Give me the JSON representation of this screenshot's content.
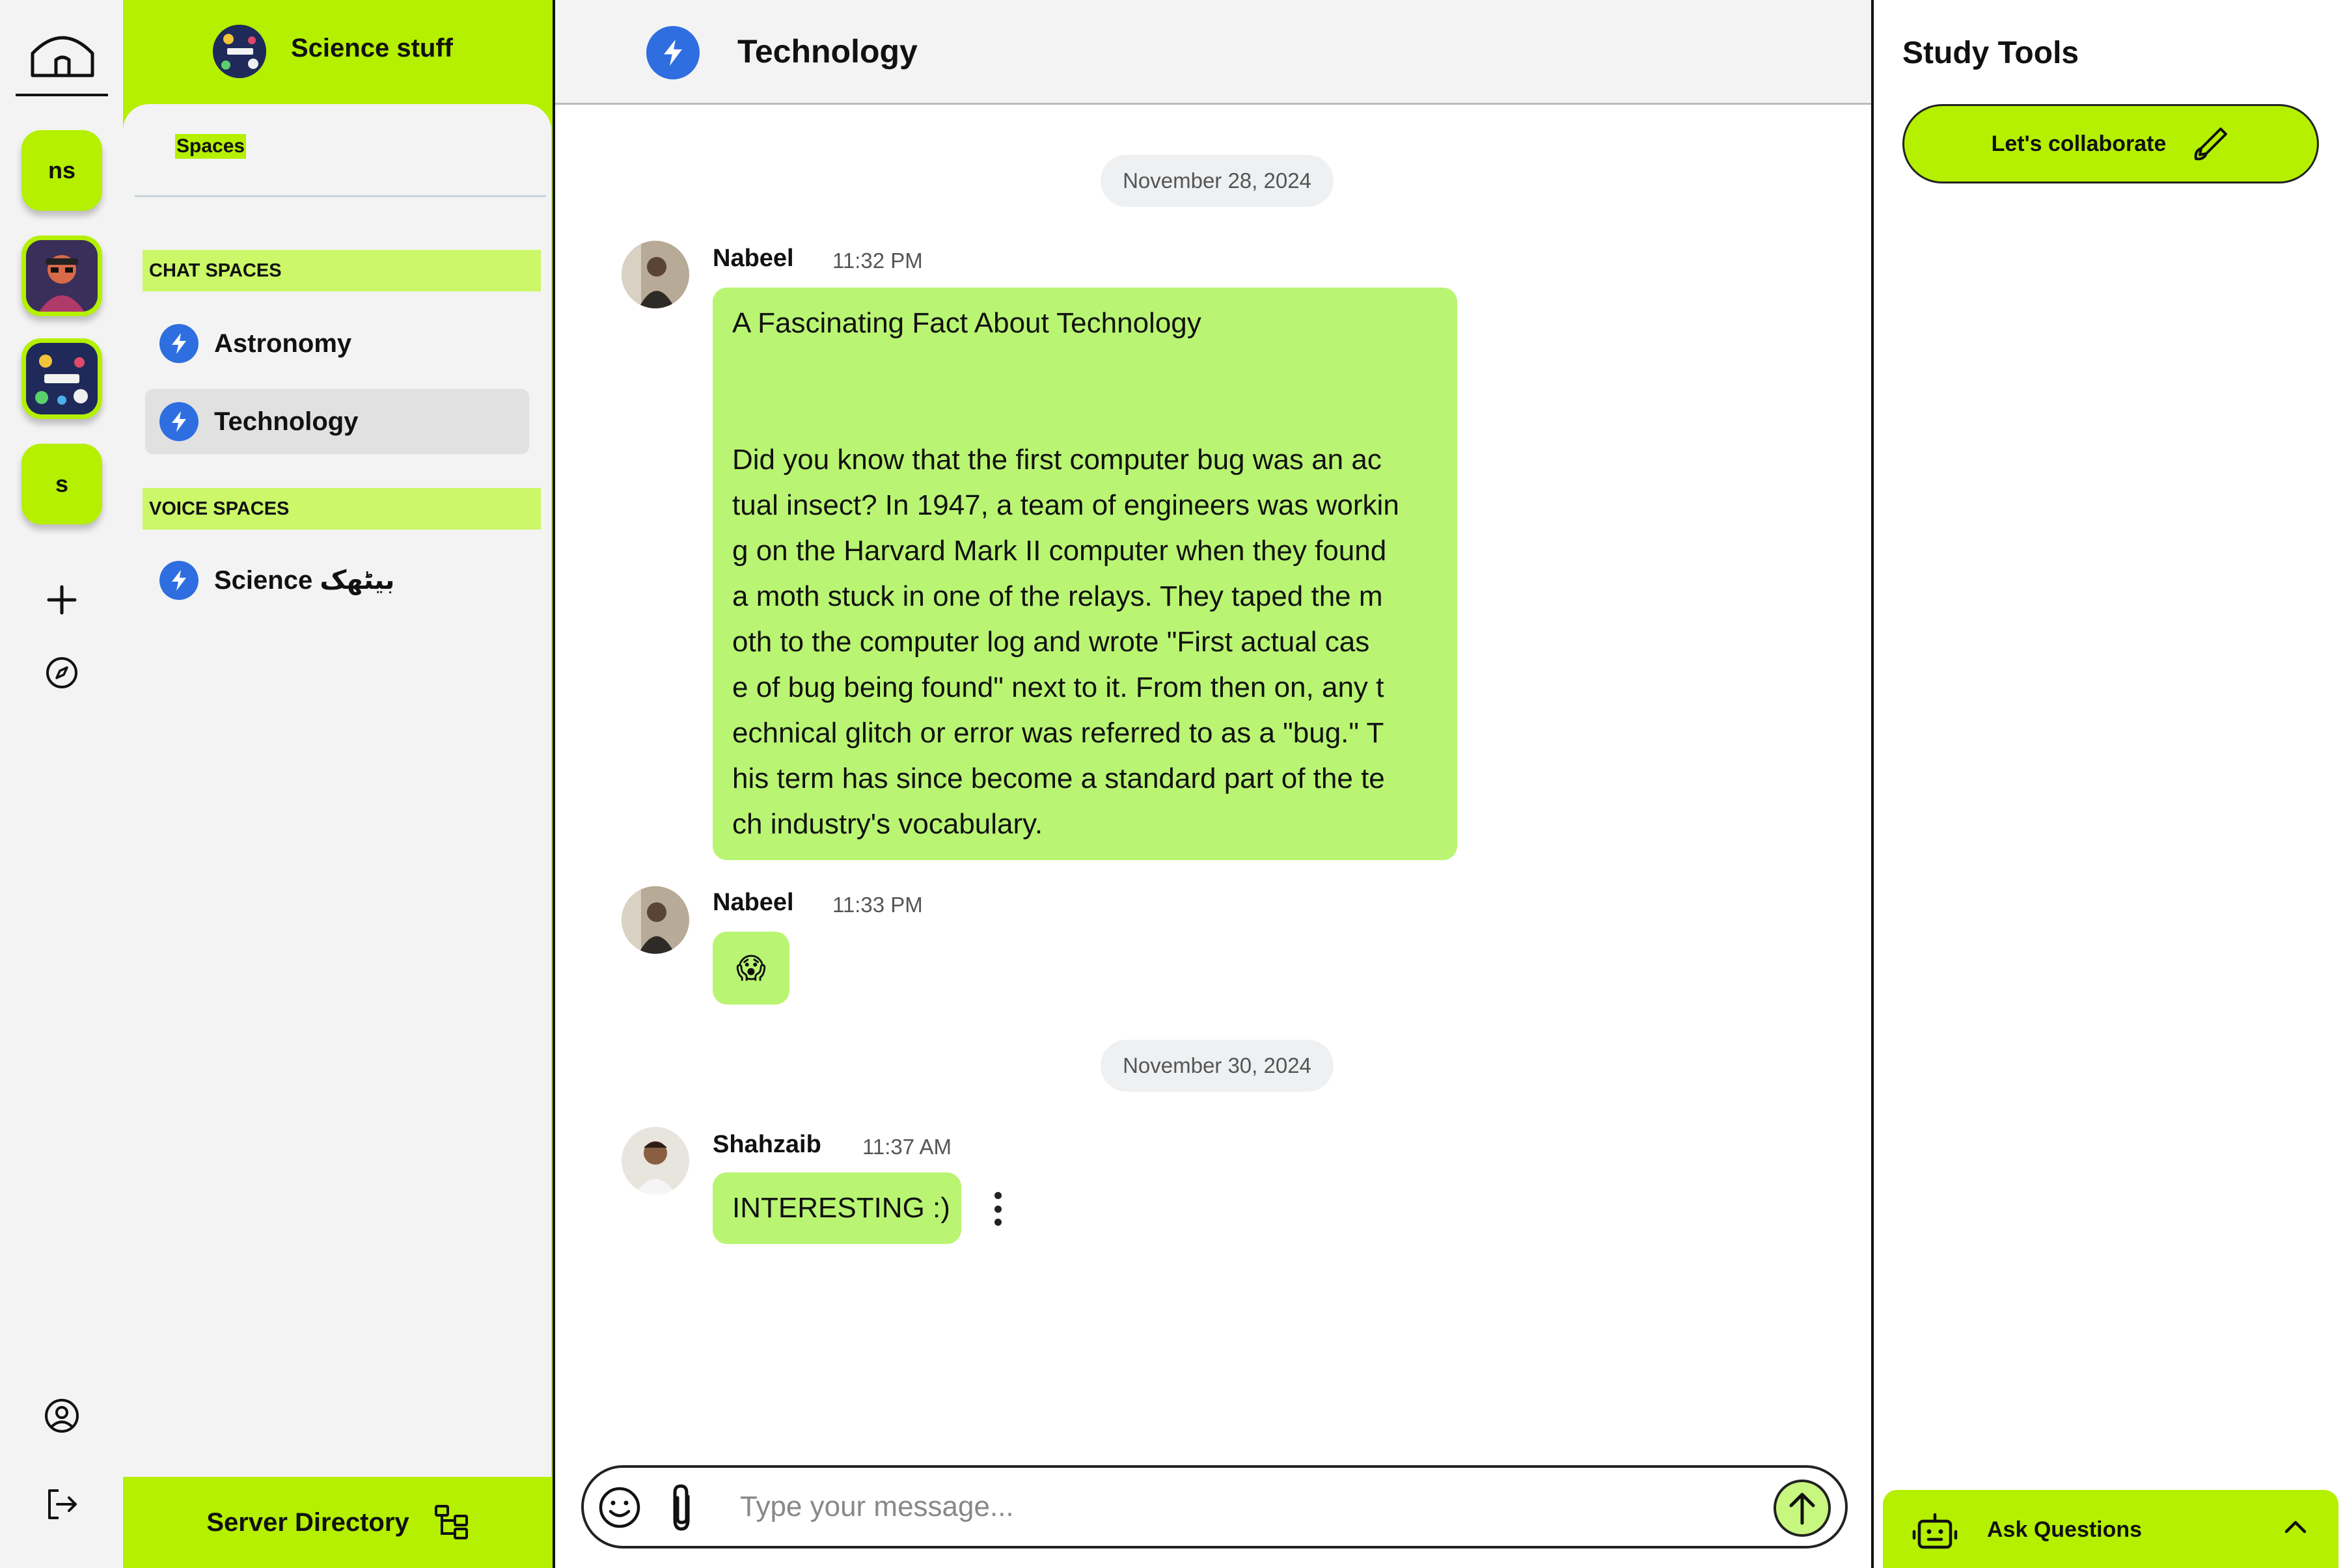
{
  "rail": {
    "servers": [
      {
        "label": "ns"
      },
      {
        "label": ""
      },
      {
        "label": ""
      },
      {
        "label": "s"
      }
    ]
  },
  "sidebar": {
    "server_name": "Science stuff",
    "spaces_tab": "Spaces",
    "chat_section": "CHAT SPACES",
    "chat_channels": [
      {
        "label": "Astronomy",
        "active": false
      },
      {
        "label": "Technology",
        "active": true
      }
    ],
    "voice_section": "VOICE SPACES",
    "voice_channels": [
      {
        "label": "Science بیٹھک"
      }
    ],
    "server_directory": "Server Directory"
  },
  "chat": {
    "channel_title": "Technology",
    "dates": [
      "November 28, 2024",
      "November 30, 2024"
    ],
    "messages": [
      {
        "sender": "Nabeel",
        "time": "11:32 PM",
        "text_lines": [
          "A Fascinating Fact About Technology",
          "",
          "",
          "Did you know that the first computer bug was an ac",
          "tual insect? In 1947, a team of engineers was workin",
          "g on the Harvard Mark II computer when they found",
          "a moth stuck in one of the relays. They taped the m",
          "oth to the computer log and wrote \"First actual cas",
          "e of bug being found\" next to it. From then on, any t",
          "echnical glitch or error was referred to as a \"bug.\" T",
          "his term has since become a standard part of the te",
          "ch industry's vocabulary."
        ]
      },
      {
        "sender": "Nabeel",
        "time": "11:33 PM",
        "text": "😱"
      },
      {
        "sender": "Shahzaib",
        "time": "11:37 AM",
        "text": "INTERESTING :)"
      }
    ],
    "composer": {
      "placeholder": "Type your message..."
    }
  },
  "tools": {
    "title": "Study Tools",
    "collaborate_label": "Let's collaborate",
    "ask_label": "Ask Questions"
  },
  "colors": {
    "accent": "#b4f000",
    "bubble": "#b9f572",
    "channel_icon": "#2f6ee0"
  },
  "icons": [
    "home-icon",
    "plus-icon",
    "compass-icon",
    "user-circle-icon",
    "logout-icon",
    "bolt-icon",
    "sitemap-icon",
    "pen-icon",
    "robot-icon",
    "chevron-up-icon",
    "emoji-icon",
    "paperclip-icon",
    "arrow-up-icon",
    "kebab-icon"
  ]
}
